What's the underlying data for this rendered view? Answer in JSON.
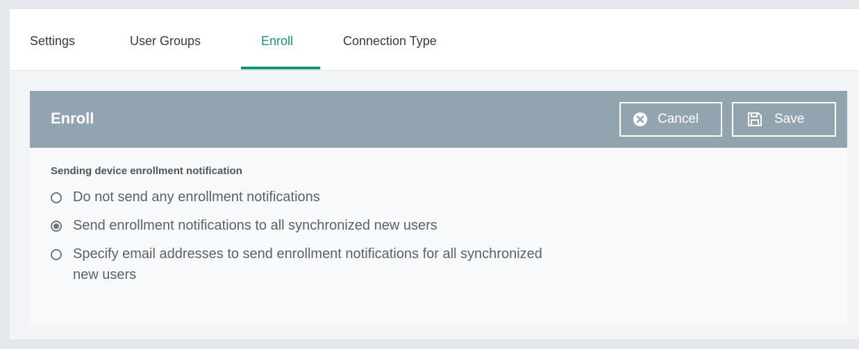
{
  "tabs": [
    {
      "label": "Settings",
      "active": false
    },
    {
      "label": "User Groups",
      "active": false
    },
    {
      "label": "Enroll",
      "active": true
    },
    {
      "label": "Connection Type",
      "active": false
    }
  ],
  "panel": {
    "title": "Enroll",
    "cancel_label": "Cancel",
    "cancel_icon": "x-circle-icon",
    "save_label": "Save",
    "save_icon": "floppy-disk-icon",
    "section_label": "Sending device enrollment notification",
    "options": [
      {
        "label": "Do not send any enrollment notifications",
        "selected": false
      },
      {
        "label": "Send enrollment notifications to all synchronized new users",
        "selected": true
      },
      {
        "label": "Specify email addresses to send enrollment notifications for all synchronized new users",
        "selected": false
      }
    ]
  },
  "colors": {
    "accent": "#10977a",
    "header_bg": "#93a4b1",
    "panel_bg": "#f7f9fa",
    "page_bg": "#e4e8ec"
  }
}
